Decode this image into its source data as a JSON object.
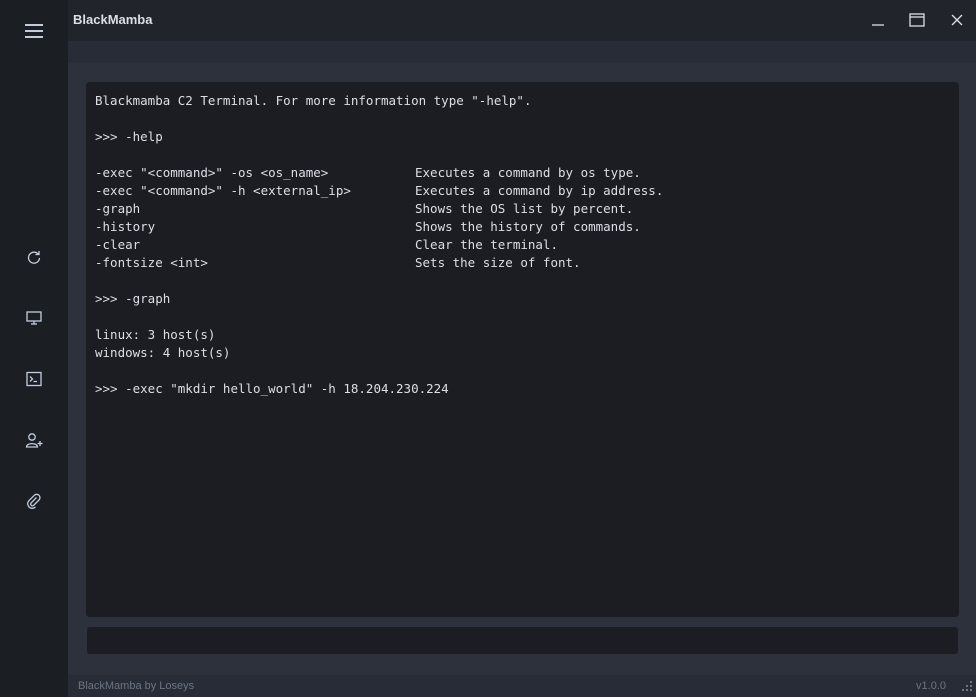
{
  "app": {
    "title": "BlackMamba"
  },
  "window_controls": [
    "minimize-icon",
    "maximize-icon",
    "close-icon"
  ],
  "sidebar": {
    "items": [
      {
        "name": "menu",
        "icon": "hamburger-menu-icon"
      },
      {
        "name": "refresh",
        "icon": "refresh-icon"
      },
      {
        "name": "hosts",
        "icon": "monitor-icon"
      },
      {
        "name": "terminal",
        "icon": "terminal-icon"
      },
      {
        "name": "add-user",
        "icon": "add-user-icon"
      },
      {
        "name": "attachment",
        "icon": "paperclip-icon"
      }
    ]
  },
  "terminal": {
    "intro": "Blackmamba C2 Terminal. For more information type \"-help\".",
    "prompt_help": ">>> -help",
    "help_rows": [
      {
        "cmd": "-exec \"<command>\" -os <os_name>",
        "desc": "Executes a command by os type."
      },
      {
        "cmd": "-exec \"<command>\" -h <external_ip>",
        "desc": "Executes a command by ip address."
      },
      {
        "cmd": "-graph",
        "desc": "Shows the OS list by percent."
      },
      {
        "cmd": "-history",
        "desc": "Shows the history of commands."
      },
      {
        "cmd": "-clear",
        "desc": "Clear the terminal."
      },
      {
        "cmd": "-fontsize <int>",
        "desc": "Sets the size of font."
      }
    ],
    "prompt_graph": ">>> -graph",
    "graph_lines": [
      "linux: 3 host(s)",
      "windows: 4 host(s)"
    ],
    "prompt_exec": ">>> -exec \"mkdir hello_world\" -h 18.204.230.224"
  },
  "input": {
    "value": "",
    "placeholder": ""
  },
  "status": {
    "credit": "BlackMamba by Loseys",
    "version": "v1.0.0"
  },
  "colors": {
    "sidebar_bg": "#1b1e23",
    "window_bg": "#2c313c",
    "terminal_bg": "#1b1d23",
    "text": "#dcdfe5",
    "muted_text": "#6c7483"
  }
}
